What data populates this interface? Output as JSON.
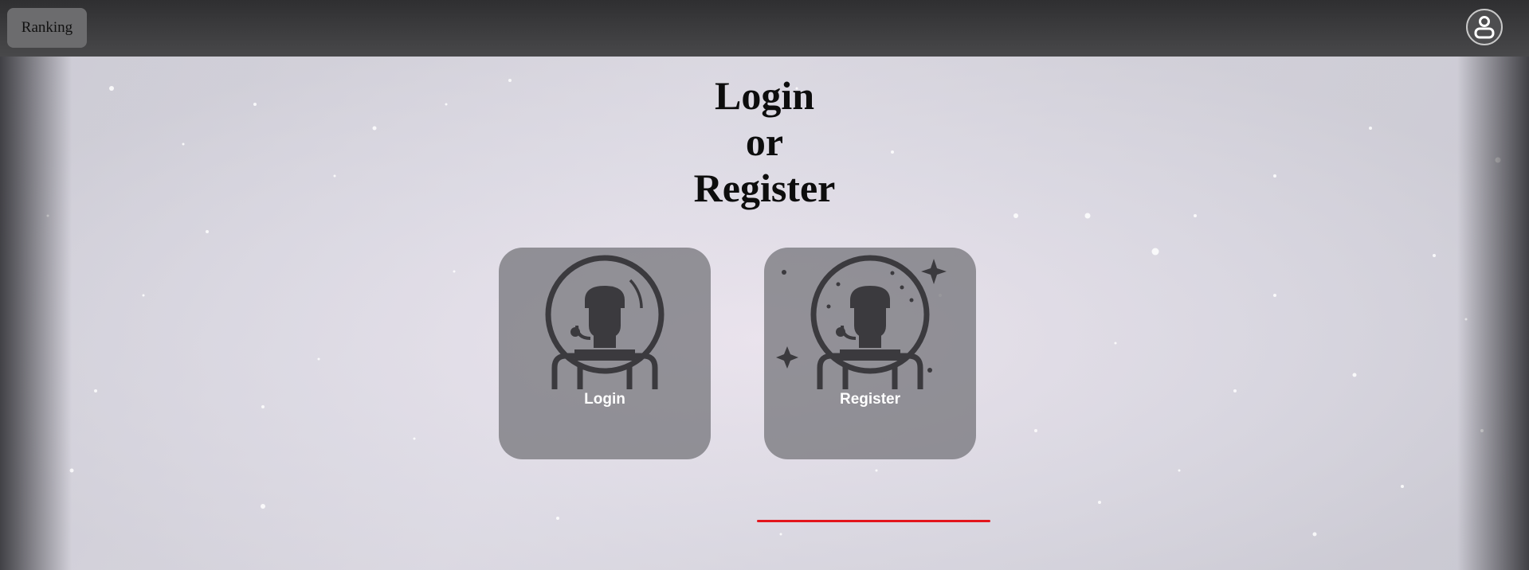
{
  "header": {
    "ranking_label": "Ranking",
    "profile_icon": "user-icon"
  },
  "main": {
    "title_lines": [
      "Login",
      "or",
      "Register"
    ],
    "login_card": {
      "label": "Login",
      "icon": "astronaut-icon"
    },
    "register_card": {
      "label": "Register",
      "icon": "astronaut-sparkles-icon"
    }
  },
  "colors": {
    "topbar": "#3a3a3c",
    "card": "#707076",
    "underline": "#e3151c",
    "icon": "#3b3a3e"
  }
}
